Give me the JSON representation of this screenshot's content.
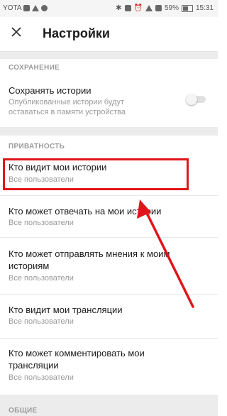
{
  "status_bar": {
    "carrier": "YOTA",
    "battery_percent": "59%",
    "time": "15:31",
    "icons": [
      "gallery-icon",
      "play-icon",
      "cloud-icon",
      "bluetooth-icon",
      "vibrate-icon",
      "alarm-icon",
      "wifi-icon",
      "signal-icon",
      "battery-icon"
    ]
  },
  "appbar": {
    "title": "Настройки",
    "close_icon": "close-icon"
  },
  "sections": {
    "save": {
      "header": "СОХРАНЕНИЕ",
      "item": {
        "title": "Сохранять истории",
        "subtitle_line1": "Опубликованные истории будут",
        "subtitle_line2": "оставаться в памяти устройства",
        "toggle_on": false
      }
    },
    "privacy": {
      "header": "ПРИВАТНОСТЬ",
      "items": [
        {
          "title_line1": "Кто видит мои истории",
          "subtitle": "Все пользователи"
        },
        {
          "title_line1": "Кто может отвечать на мои истории",
          "subtitle": "Все пользователи"
        },
        {
          "title_line1": "Кто может отправлять мнения к моим",
          "title_line2": "историям",
          "subtitle": "Все пользователи"
        },
        {
          "title_line1": "Кто видит мои трансляции",
          "subtitle": "Все пользователи"
        },
        {
          "title_line1": "Кто может комментировать мои",
          "title_line2": "трансляции",
          "subtitle": "Все пользователи"
        }
      ]
    },
    "general": {
      "header": "ОБЩИЕ"
    }
  },
  "annotation": {
    "color": "#e0151b"
  }
}
